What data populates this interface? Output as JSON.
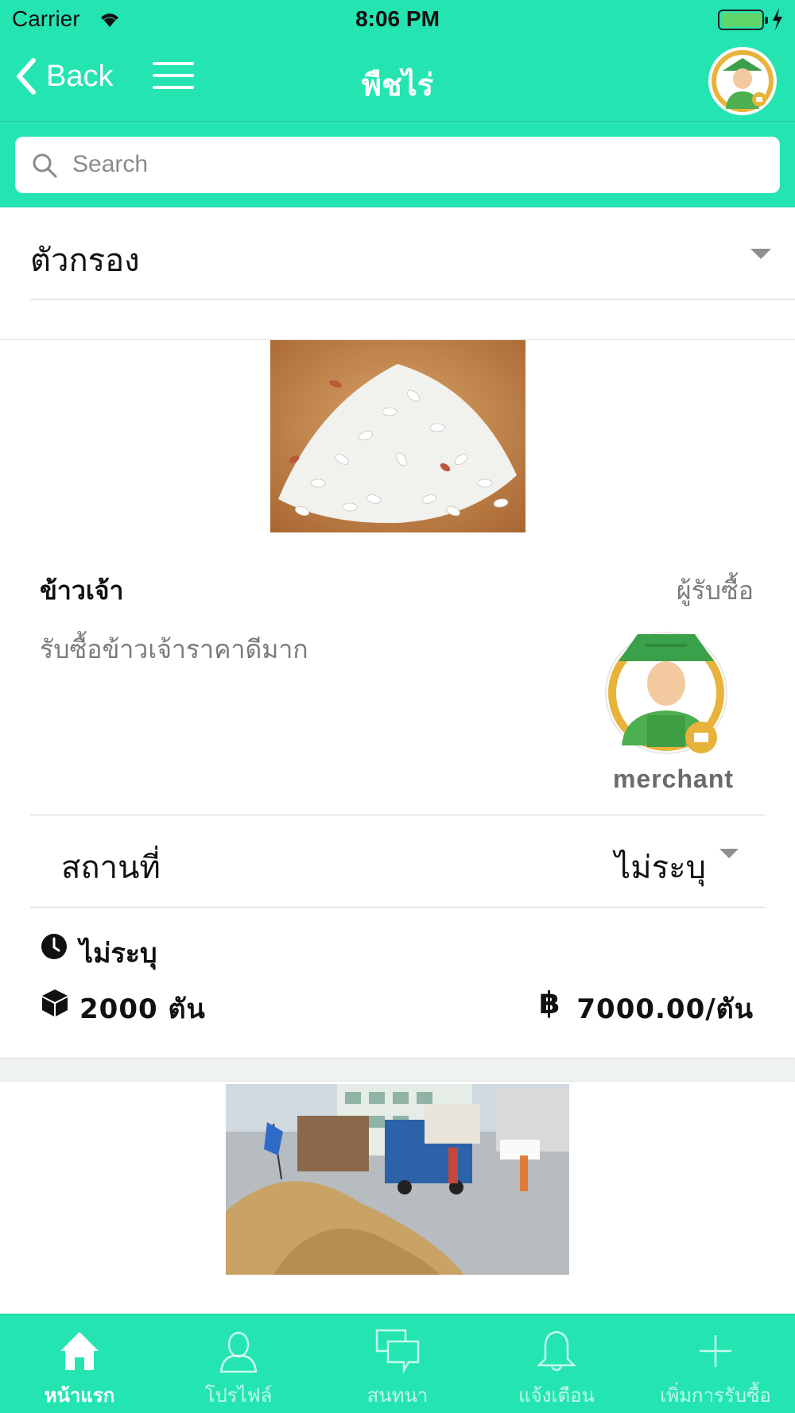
{
  "status_bar": {
    "carrier": "Carrier",
    "time": "8:06 PM"
  },
  "nav": {
    "back_label": "Back",
    "title": "พืชไร่"
  },
  "search": {
    "placeholder": "Search",
    "value": ""
  },
  "filter": {
    "label": "ตัวกรอง"
  },
  "listing": {
    "product_name": "ข้าวเจ้า",
    "role": "ผู้รับซื้อ",
    "description": "รับซื้อข้าวเจ้าราคาดีมาก",
    "merchant_name": "merchant",
    "location_label": "สถานที่",
    "location_value": "ไม่ระบุ",
    "time_value": "ไม่ระบุ",
    "quantity": "2000  ตัน",
    "price": "7000.00/ตัน"
  },
  "tabs": [
    {
      "label": "หน้าแรก",
      "icon": "home-icon",
      "active": true
    },
    {
      "label": "โปรไฟล์",
      "icon": "profile-icon",
      "active": false
    },
    {
      "label": "สนทนา",
      "icon": "chat-icon",
      "active": false
    },
    {
      "label": "แจ้งเตือน",
      "icon": "bell-icon",
      "active": false
    },
    {
      "label": "เพิ่มการรับซื้อ",
      "icon": "plus-icon",
      "active": false
    }
  ],
  "colors": {
    "accent": "#24e4b2",
    "muted_text": "#7b7b7b",
    "divider": "#cfcfcf"
  }
}
